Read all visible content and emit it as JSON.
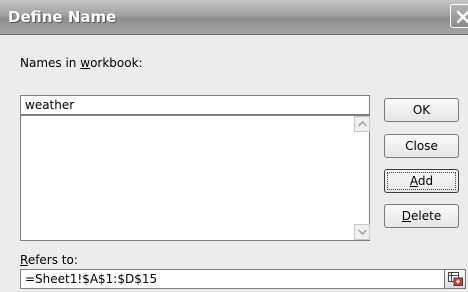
{
  "dialog": {
    "title": "Define Name"
  },
  "names_label": {
    "pre": "Names in ",
    "accel": "w",
    "post": "orkbook:"
  },
  "name_input": {
    "value": "weather"
  },
  "names_list": {
    "items": []
  },
  "buttons": {
    "ok": "OK",
    "close": "Close",
    "add": {
      "pre": "",
      "accel": "A",
      "post": "dd"
    },
    "delete": {
      "pre": "",
      "accel": "D",
      "post": "elete"
    }
  },
  "refers_label": {
    "pre": "",
    "accel": "R",
    "post": "efers to:"
  },
  "refers_input": {
    "value": "=Sheet1!$A$1:$D$15"
  },
  "icons": {
    "close": "close-icon",
    "scroll_up": "arrow-up-icon",
    "scroll_down": "arrow-down-icon",
    "collapse_dialog": "collapse-dialog-icon"
  }
}
